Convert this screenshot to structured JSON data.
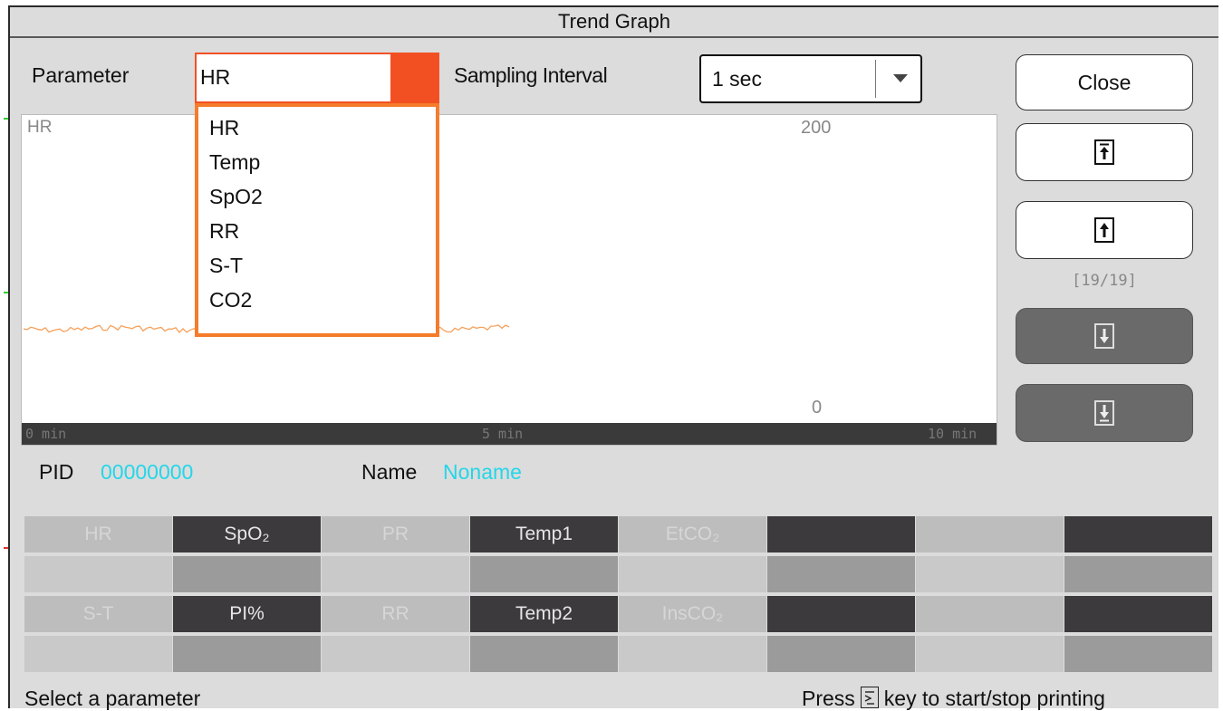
{
  "window": {
    "title": "Trend Graph"
  },
  "controls": {
    "parameter_label": "Parameter",
    "parameter_value": "HR",
    "parameter_options": [
      "HR",
      "Temp",
      "SpO2",
      "RR",
      "S-T",
      "CO2"
    ],
    "interval_label": "Sampling Interval",
    "interval_value": "1 sec"
  },
  "graph": {
    "param_label": "HR",
    "y_max_label": "200",
    "y_min_label": "0",
    "x_labels": [
      "0 min",
      "5 min",
      "10 min"
    ],
    "trace_color": "#f5a05a",
    "ylim": [
      0,
      200
    ],
    "xlim_min": [
      0,
      10
    ]
  },
  "side_buttons": {
    "close_label": "Close",
    "page_count": "[19/19]"
  },
  "patient": {
    "pid_label": "PID",
    "pid_value": "00000000",
    "name_label": "Name",
    "name_value": "Noname"
  },
  "param_grid": {
    "row1": [
      "HR",
      "SpO₂",
      "PR",
      "Temp1",
      "EtCO₂",
      "",
      "",
      ""
    ],
    "row2": [
      "S-T",
      "PI%",
      "RR",
      "Temp2",
      "InsCO₂",
      "",
      "",
      ""
    ]
  },
  "status": {
    "left": "Select a parameter",
    "right_prefix": "Press",
    "right_suffix": "key to start/stop printing"
  },
  "colors": {
    "accent": "#f25022",
    "dropdown_border": "#f57c2b",
    "value_text": "#24d6e8"
  }
}
